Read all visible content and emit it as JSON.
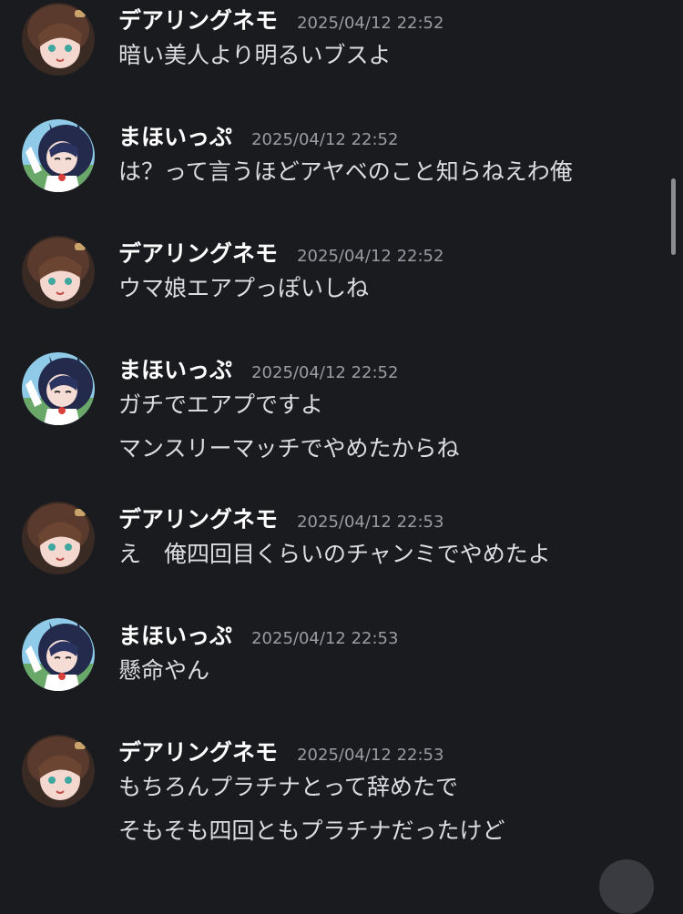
{
  "authors": {
    "nemo": "デアリングネモ",
    "maho": "まほいっぷ"
  },
  "messages": [
    {
      "author": "デアリングネモ",
      "time": "2025/04/12 22:52",
      "lines": [
        "暗い美人より明るいブスよ"
      ]
    },
    {
      "author": "まほいっぷ",
      "time": "2025/04/12 22:52",
      "lines": [
        "は？って言うほどアヤベのこと知らねえわ俺"
      ]
    },
    {
      "author": "デアリングネモ",
      "time": "2025/04/12 22:52",
      "lines": [
        "ウマ娘エアプっぽいしね"
      ]
    },
    {
      "author": "まほいっぷ",
      "time": "2025/04/12 22:52",
      "lines": [
        "ガチでエアプですよ",
        "マンスリーマッチでやめたからね"
      ]
    },
    {
      "author": "デアリングネモ",
      "time": "2025/04/12 22:53",
      "lines": [
        "え　俺四回目くらいのチャンミでやめたよ"
      ]
    },
    {
      "author": "まほいっぷ",
      "time": "2025/04/12 22:53",
      "lines": [
        "懸命やん"
      ]
    },
    {
      "author": "デアリングネモ",
      "time": "2025/04/12 22:53",
      "lines": [
        "もちろんプラチナとって辞めたで",
        "そもそも四回ともプラチナだったけど"
      ]
    }
  ],
  "icons": {
    "avatar_nemo": "avatar-brown-hair-girl",
    "avatar_maho": "avatar-navy-hair-girl"
  },
  "colors": {
    "background": "#1a1b1f",
    "author": "#ffffff",
    "timestamp": "#9a9ba3",
    "message_text": "#dcdde1"
  }
}
